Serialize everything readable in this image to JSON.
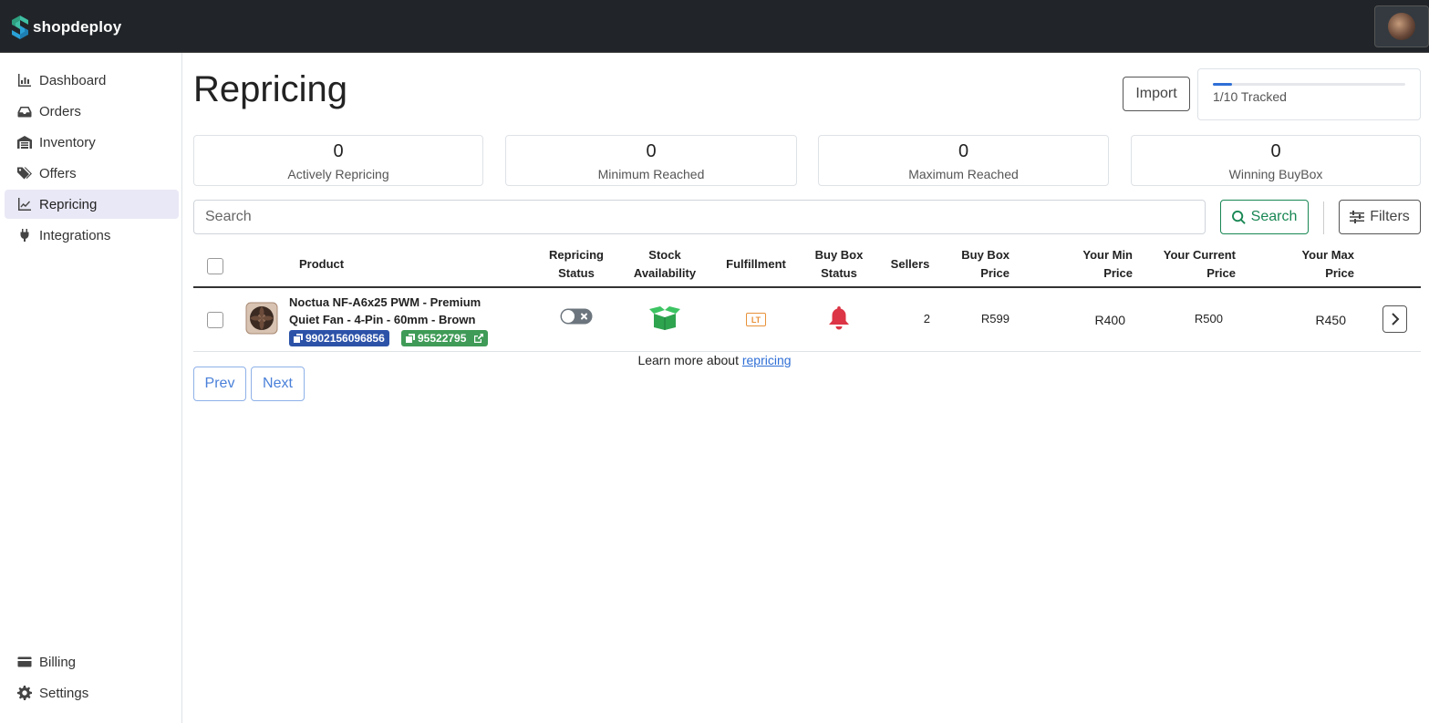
{
  "app": {
    "brand": "shopdeploy"
  },
  "sidebar": {
    "items": [
      {
        "label": "Dashboard",
        "icon": "chart-bar-icon"
      },
      {
        "label": "Orders",
        "icon": "inbox-icon"
      },
      {
        "label": "Inventory",
        "icon": "warehouse-icon"
      },
      {
        "label": "Offers",
        "icon": "tags-icon"
      },
      {
        "label": "Repricing",
        "icon": "chart-line-icon",
        "active": true
      },
      {
        "label": "Integrations",
        "icon": "plug-icon"
      }
    ],
    "bottom": [
      {
        "label": "Billing",
        "icon": "credit-card-icon"
      },
      {
        "label": "Settings",
        "icon": "gear-icon"
      }
    ]
  },
  "page": {
    "title": "Repricing",
    "import_label": "Import",
    "tracked": {
      "text": "1/10 Tracked",
      "fraction": 0.1
    }
  },
  "stats": [
    {
      "value": "0",
      "label": "Actively Repricing"
    },
    {
      "value": "0",
      "label": "Minimum Reached"
    },
    {
      "value": "0",
      "label": "Maximum Reached"
    },
    {
      "value": "0",
      "label": "Winning BuyBox"
    }
  ],
  "search": {
    "placeholder": "Search",
    "button": "Search",
    "filters": "Filters"
  },
  "table": {
    "headers": {
      "product": "Product",
      "repricing_status": [
        "Repricing",
        "Status"
      ],
      "stock": [
        "Stock",
        "Availability"
      ],
      "fulfillment": "Fulfillment",
      "buybox_status": [
        "Buy Box",
        "Status"
      ],
      "sellers": "Sellers",
      "buybox_price": [
        "Buy Box",
        "Price"
      ],
      "min_price": [
        "Your Min",
        "Price"
      ],
      "current_price": [
        "Your Current",
        "Price"
      ],
      "max_price": [
        "Your Max",
        "Price"
      ]
    },
    "rows": [
      {
        "title": "Noctua NF-A6x25 PWM - Premium Quiet Fan - 4-Pin - 60mm - Brown",
        "barcode": "9902156096856",
        "plid": "95522795",
        "fulfillment_badge": "LT",
        "sellers": "2",
        "buybox_price": "R599",
        "min_price": "R400",
        "current_price": "R500",
        "max_price": "R450"
      }
    ]
  },
  "pagination": {
    "prev": "Prev",
    "next": "Next"
  },
  "footer": {
    "learn_text": "Learn more about",
    "learn_link": "repricing"
  },
  "colors": {
    "accent": "#198754",
    "badge_blue": "#2c52a8",
    "badge_green": "#3f9b57",
    "bell_red": "#dc3545",
    "lt_orange": "#e8913a"
  }
}
